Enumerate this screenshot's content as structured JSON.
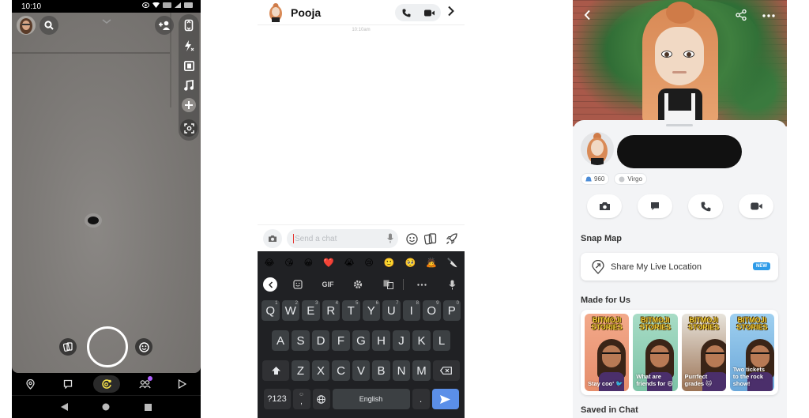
{
  "camera": {
    "status_time": "10:10",
    "status_icons": [
      "eye-icon",
      "wifi-icon",
      "volte-icon",
      "signal-icon",
      "battery-icon"
    ],
    "top_left": [
      "bitmoji-avatar",
      "search-icon"
    ],
    "top_center": "chevron-down-icon",
    "top_right": [
      "add-friend-icon",
      "flip-camera-icon"
    ],
    "side_tools": [
      "flash-off-icon",
      "video-frame-icon",
      "music-icon",
      "plus-icon",
      "scan-icon"
    ],
    "bottom_tools": [
      "memories-icon",
      "lens-icon"
    ],
    "nav": [
      {
        "name": "map",
        "icon": "map-pin-icon",
        "active": false
      },
      {
        "name": "chat",
        "icon": "chat-icon",
        "active": false
      },
      {
        "name": "camera",
        "icon": "camera-refresh-icon",
        "active": true
      },
      {
        "name": "stories",
        "icon": "friends-icon",
        "active": false,
        "badge": true
      },
      {
        "name": "spotlight",
        "icon": "play-icon",
        "active": false
      }
    ],
    "system_nav": [
      "back-icon",
      "home-icon",
      "recents-icon"
    ],
    "colors": {
      "active_nav": "#f5e14a",
      "badge": "#b060ff"
    }
  },
  "chat": {
    "contact_name": "Pooja",
    "timestamp": "10:10am",
    "input_placeholder": "Send a chat",
    "emoji_suggestions": [
      "😂",
      "😘",
      "😀",
      "❤️",
      "😭",
      "😢",
      "🙂",
      "🥺",
      "🙇",
      "🔪"
    ],
    "keyboard_tools": {
      "gif": "GIF"
    },
    "rows": [
      [
        {
          "k": "Q",
          "n": "1"
        },
        {
          "k": "W",
          "n": "2"
        },
        {
          "k": "E",
          "n": "3"
        },
        {
          "k": "R",
          "n": "4"
        },
        {
          "k": "T",
          "n": "5"
        },
        {
          "k": "Y",
          "n": "6"
        },
        {
          "k": "U",
          "n": "7"
        },
        {
          "k": "I",
          "n": "8"
        },
        {
          "k": "O",
          "n": "9"
        },
        {
          "k": "P",
          "n": "0"
        }
      ],
      [
        {
          "k": "A"
        },
        {
          "k": "S"
        },
        {
          "k": "D"
        },
        {
          "k": "F"
        },
        {
          "k": "G"
        },
        {
          "k": "H"
        },
        {
          "k": "J"
        },
        {
          "k": "K"
        },
        {
          "k": "L"
        }
      ],
      [
        {
          "k": "Z"
        },
        {
          "k": "X"
        },
        {
          "k": "C"
        },
        {
          "k": "V"
        },
        {
          "k": "B"
        },
        {
          "k": "N"
        },
        {
          "k": "M"
        }
      ]
    ],
    "symbols_key": "?123",
    "comma_key": ",",
    "space_label": "English",
    "period_key": ".",
    "colors": {
      "send": "#5b8fe8",
      "keyboard_bg": "#202124",
      "key_bg": "#3c4043"
    }
  },
  "profile": {
    "snap_score": "960",
    "zodiac": "Virgo",
    "actions": [
      "camera-icon",
      "chat-bubble-icon",
      "phone-icon",
      "video-icon"
    ],
    "snap_map_title": "Snap Map",
    "share_location_label": "Share My Live Location",
    "new_badge": "NEW",
    "made_for_us_title": "Made for Us",
    "stories": [
      {
        "logo1": "BITMOJI",
        "logo2": "STORIES",
        "caption": "Stay coo' 🐦",
        "bg": "linear-gradient(#f3a98a,#e58d6b)"
      },
      {
        "logo1": "BITMOJI",
        "logo2": "STORIES",
        "caption": "What are friends for 😄",
        "bg": "linear-gradient(#a8dcc6,#7cc3a6)"
      },
      {
        "logo1": "BITMOJI",
        "logo2": "STORIES",
        "caption": "Purrfect grades 🐱",
        "bg": "linear-gradient(#e8e4dc,#9b7355)"
      },
      {
        "logo1": "BITMOJI",
        "logo2": "STORIES",
        "caption": "Two tickets to the rock show!",
        "bg": "linear-gradient(#9fd0f0,#6aa6d8)"
      }
    ],
    "saved_in_chat_title": "Saved in Chat",
    "colors": {
      "new_badge": "#2e9be8",
      "redaction": "#111111"
    }
  }
}
